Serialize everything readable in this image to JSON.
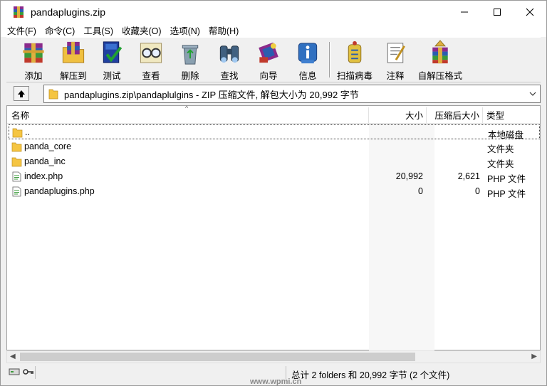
{
  "window": {
    "title": "pandaplugins.zip",
    "controls": [
      "minimize",
      "maximize",
      "close"
    ]
  },
  "menu": [
    "文件(F)",
    "命令(C)",
    "工具(S)",
    "收藏夹(O)",
    "选项(N)",
    "帮助(H)"
  ],
  "toolbar": {
    "add": "添加",
    "extract_to": "解压到",
    "test": "测试",
    "view": "查看",
    "delete": "删除",
    "find": "查找",
    "wizard": "向导",
    "info": "信息",
    "virus_scan": "扫描病毒",
    "comment": "注释",
    "sfx": "自解压格式"
  },
  "address": {
    "path": "pandaplugins.zip\\pandaplulgins - ZIP 压缩文件, 解包大小为 20,992 字节"
  },
  "columns": {
    "name": "名称",
    "size": "大小",
    "packed": "压缩后大小",
    "type": "类型"
  },
  "files": [
    {
      "name": "..",
      "size": "",
      "packed": "",
      "type": "本地磁盘",
      "icon": "folder-icon"
    },
    {
      "name": "panda_core",
      "size": "",
      "packed": "",
      "type": "文件夹",
      "icon": "folder-icon"
    },
    {
      "name": "panda_inc",
      "size": "",
      "packed": "",
      "type": "文件夹",
      "icon": "folder-icon"
    },
    {
      "name": "index.php",
      "size": "20,992",
      "packed": "2,621",
      "type": "PHP 文件",
      "icon": "php-file-icon"
    },
    {
      "name": "pandaplugins.php",
      "size": "0",
      "packed": "0",
      "type": "PHP 文件",
      "icon": "php-file-icon"
    }
  ],
  "status": {
    "summary": "总计 2 folders 和 20,992 字节 (2 个文件)"
  },
  "watermark": "www.wpmi.cn",
  "colors": {
    "folder": "#f5c542",
    "accent": "#2a5db0"
  }
}
